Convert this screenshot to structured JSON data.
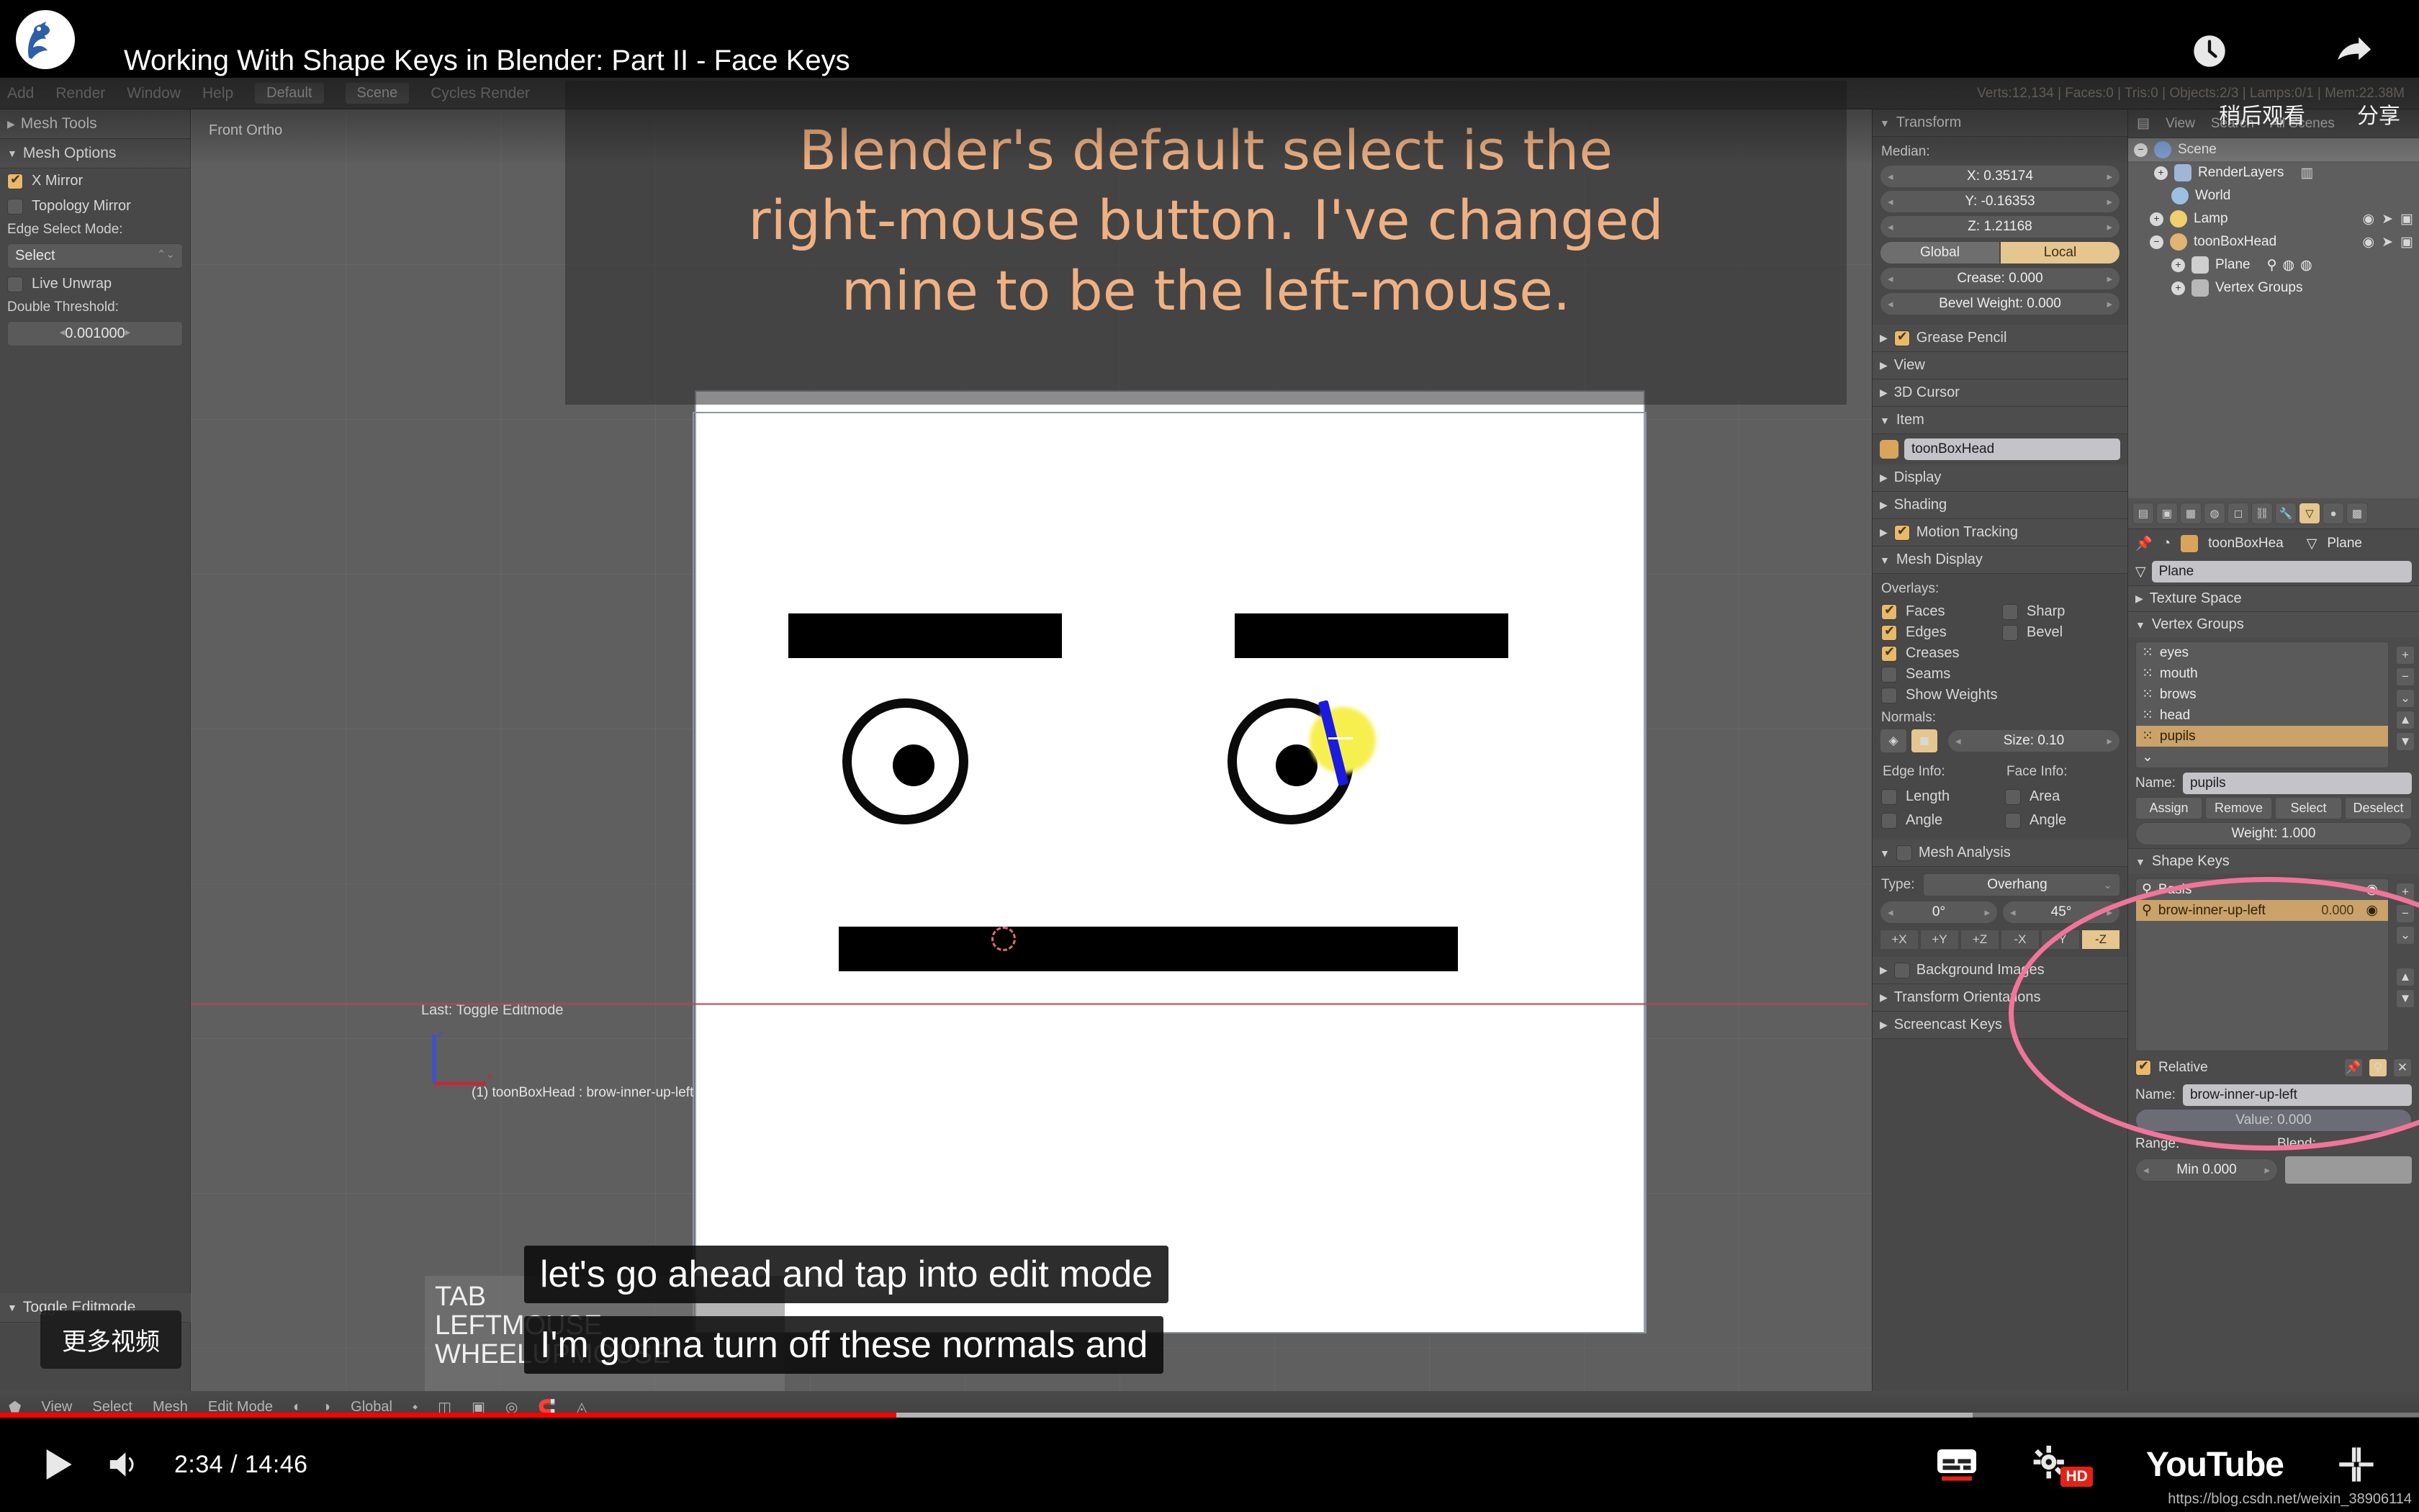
{
  "youtube": {
    "video_title": "Working With Shape Keys in Blender: Part II - Face Keys",
    "watch_later_label": "稍后观看",
    "share_label": "分享",
    "more_videos_label": "更多视频",
    "current_time": "2:34",
    "total_time": "14:46",
    "time_display": "2:34 / 14:46",
    "wordmark": "YouTube",
    "hd_badge": "HD",
    "watermark": "https://blog.csdn.net/weixin_38906114",
    "icons": {
      "play": "play-icon",
      "volume": "volume-icon",
      "watch_later": "clock-icon",
      "share": "share-arrow-icon",
      "subtitles": "subtitles-icon",
      "settings": "gear-icon",
      "fullscreen": "fullscreen-icon"
    },
    "accent_color": "#ff0000",
    "captions": [
      "let's go ahead and tap into edit mode",
      "I'm gonna turn off these normals and"
    ]
  },
  "overlay_note": {
    "lines": [
      "Blender's default select is the",
      "right-mouse button. I've changed",
      "mine to be the left-mouse."
    ],
    "color": "#f0b182"
  },
  "blender": {
    "topbar": {
      "menus": [
        "Add",
        "Render",
        "Window",
        "Help"
      ],
      "screen_layout": "Default",
      "scene": "Scene",
      "render_engine": "Cycles Render",
      "stats": "Verts:12,134 | Faces:0 | Tris:0 | Objects:2/3 | Lamps:0/1 | Mem:22.38M"
    },
    "left_panel": {
      "mesh_tools_label": "Mesh Tools",
      "mesh_options_label": "Mesh Options",
      "x_mirror": {
        "label": "X Mirror",
        "checked": true
      },
      "topology_mirror": {
        "label": "Topology Mirror",
        "checked": false
      },
      "edge_select_mode_label": "Edge Select Mode:",
      "edge_select_mode_value": "Select",
      "live_unwrap": {
        "label": "Live Unwrap",
        "checked": false
      },
      "double_threshold_label": "Double Threshold:",
      "double_threshold_value": "0.001000",
      "toggle_editmode_label": "Toggle Editmode"
    },
    "viewport": {
      "view_label": "Front Ortho",
      "last_operator": "Last: Toggle Editmode",
      "object_info": "(1) toonBoxHead : brow-inner-up-left",
      "screencast_keys": [
        "TAB",
        "LEFTMOUSE",
        "WHEELUPMOUSE"
      ]
    },
    "npanel": {
      "transform_label": "Transform",
      "median_label": "Median:",
      "median_x": "X: 0.35174",
      "median_y": "Y: -0.16353",
      "median_z": "Z: 1.21168",
      "global_label": "Global",
      "local_label": "Local",
      "crease": "Crease: 0.000",
      "bevel_weight": "Bevel Weight: 0.000",
      "grease_pencil": {
        "label": "Grease Pencil",
        "checked": true
      },
      "view_label": "View",
      "cursor_label": "3D Cursor",
      "item_label": "Item",
      "item_name": "toonBoxHead",
      "display_label": "Display",
      "shading_label": "Shading",
      "motion_tracking": {
        "label": "Motion Tracking",
        "checked": true
      },
      "mesh_display_label": "Mesh Display",
      "overlays_label": "Overlays:",
      "overlays": [
        {
          "label": "Faces",
          "checked": true
        },
        {
          "label": "Sharp",
          "checked": false
        },
        {
          "label": "Edges",
          "checked": true
        },
        {
          "label": "Bevel",
          "checked": false
        },
        {
          "label": "Creases",
          "checked": true
        },
        {
          "label": "",
          "checked": false
        },
        {
          "label": "Seams",
          "checked": false
        },
        {
          "label": "",
          "checked": false
        },
        {
          "label": "Show Weights",
          "checked": false
        },
        {
          "label": "",
          "checked": false
        }
      ],
      "normals_label": "Normals:",
      "normals_size": "Size: 0.10",
      "edge_info_label": "Edge Info:",
      "face_info_label": "Face Info:",
      "edge_length": "Length",
      "edge_angle": "Angle",
      "face_area": "Area",
      "face_angle": "Angle",
      "mesh_analysis_label": "Mesh Analysis",
      "analysis_type_label": "Type:",
      "analysis_type_value": "Overhang",
      "analysis_min": "0°",
      "analysis_max": "45°",
      "axis_buttons": [
        "+X",
        "+Y",
        "+Z",
        "-X",
        "-Y",
        "-Z"
      ],
      "axis_selected": "-Z",
      "background_images_label": "Background Images",
      "transform_orientations_label": "Transform Orientations",
      "screencast_keys_label": "Screencast Keys"
    },
    "outliner": {
      "menus": [
        "View",
        "Search",
        "All Scenes"
      ],
      "rows": [
        {
          "label": "Scene",
          "icon": "scene-icon",
          "depth": 0,
          "selected": true
        },
        {
          "label": "RenderLayers",
          "icon": "renderlayers-icon",
          "depth": 1,
          "selected": false
        },
        {
          "label": "World",
          "icon": "world-icon",
          "depth": 1,
          "selected": false
        },
        {
          "label": "Lamp",
          "icon": "lamp-icon",
          "depth": 1,
          "selected": false
        },
        {
          "label": "toonBoxHead",
          "icon": "mesh-object-icon",
          "depth": 1,
          "selected": false
        },
        {
          "label": "Plane",
          "icon": "mesh-data-icon",
          "depth": 2,
          "selected": false
        },
        {
          "label": "Vertex Groups",
          "icon": "vertexgroup-icon",
          "depth": 2,
          "selected": false
        }
      ]
    },
    "properties": {
      "breadcrumb_object": "toonBoxHea",
      "breadcrumb_data": "Plane",
      "mesh_datablock": "Plane",
      "texture_space_label": "Texture Space",
      "vertex_groups_label": "Vertex Groups",
      "vertex_groups": [
        {
          "name": "eyes",
          "selected": false
        },
        {
          "name": "mouth",
          "selected": false
        },
        {
          "name": "brows",
          "selected": false
        },
        {
          "name": "head",
          "selected": false
        },
        {
          "name": "pupils",
          "selected": true
        }
      ],
      "vg_name_label": "Name:",
      "vg_name_value": "pupils",
      "vg_buttons": [
        "Assign",
        "Remove",
        "Select",
        "Deselect"
      ],
      "vg_weight": "Weight: 1.000",
      "shape_keys_label": "Shape Keys",
      "shape_keys": [
        {
          "name": "Basis",
          "value": "",
          "selected": false
        },
        {
          "name": "brow-inner-up-left",
          "value": "0.000",
          "selected": true
        }
      ],
      "relative_label": "Relative",
      "relative_checked": true,
      "sk_name_label": "Name:",
      "sk_name_value": "brow-inner-up-left",
      "sk_value": "Value: 0.000",
      "range_label": "Range:",
      "blend_label": "Blend:",
      "range_min": "Min 0.000"
    },
    "statusbar": {
      "menus": [
        "View",
        "Select",
        "Mesh"
      ],
      "mode": "Edit Mode",
      "orientation": "Global"
    }
  }
}
